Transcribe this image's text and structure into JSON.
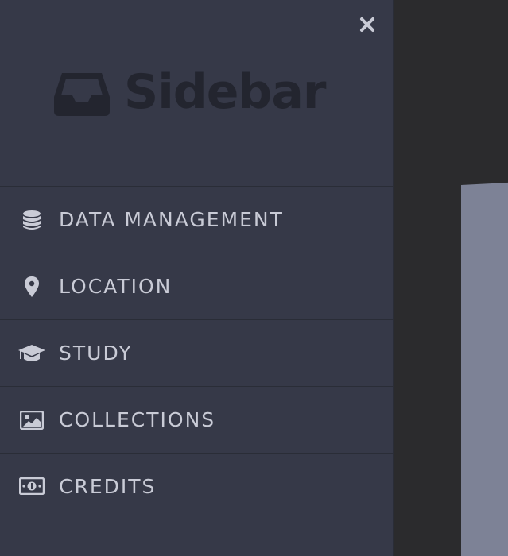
{
  "sidebar": {
    "brand": {
      "title": "Sidebar",
      "icon": "inbox-icon"
    },
    "close": {
      "icon": "close-icon",
      "glyph": "×"
    },
    "items": [
      {
        "label": "DATA MANAGEMENT",
        "icon": "database-icon"
      },
      {
        "label": "LOCATION",
        "icon": "map-pin-icon"
      },
      {
        "label": "STUDY",
        "icon": "graduation-cap-icon"
      },
      {
        "label": "COLLECTIONS",
        "icon": "image-icon"
      },
      {
        "label": "CREDITS",
        "icon": "money-bill-icon"
      }
    ]
  },
  "colors": {
    "sidebar_bg": "#363948",
    "page_bg": "#2b2b2d",
    "menu_text": "#c9cbd6",
    "brand_text": "#23252f",
    "content_panel": "#7d8296"
  }
}
